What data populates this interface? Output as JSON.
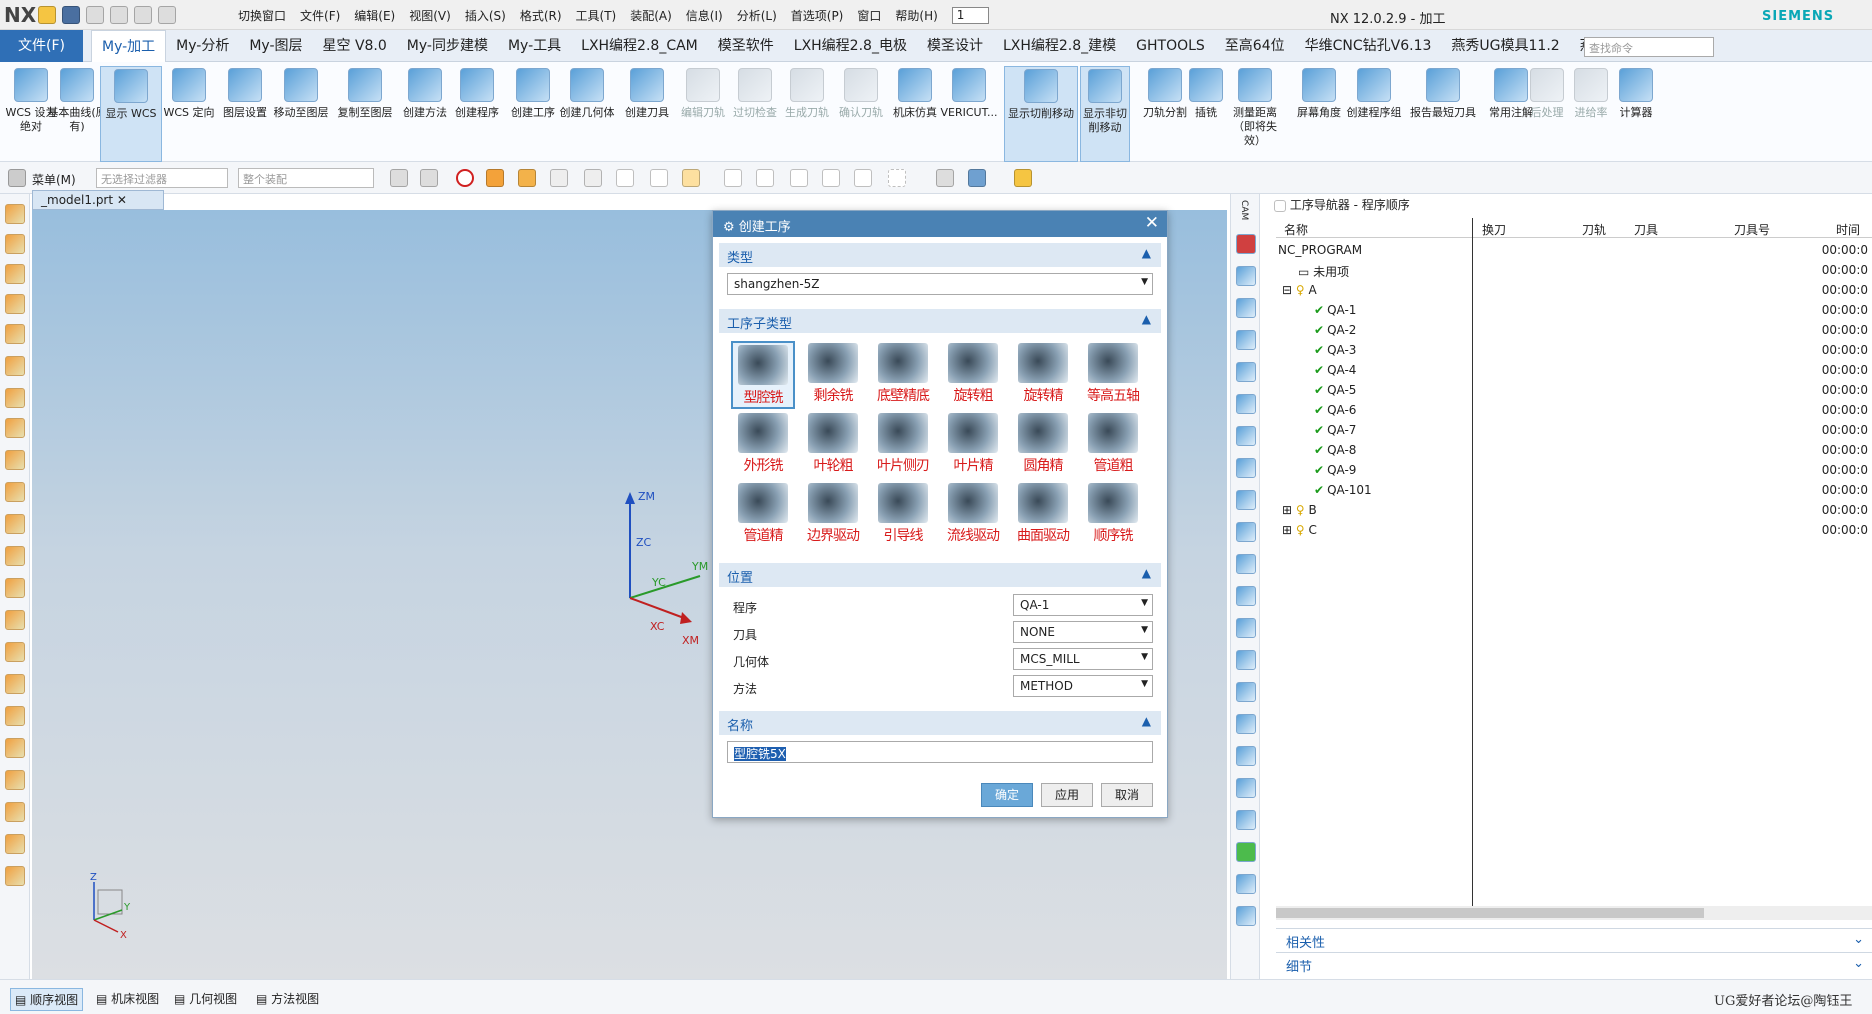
{
  "titlebar": {
    "logo": "NX",
    "window_title": "NX 12.0.2.9 - 加工",
    "brand": "SIEMENS",
    "menus": [
      "切换窗口",
      "文件(F)",
      "编辑(E)",
      "视图(V)",
      "插入(S)",
      "格式(R)",
      "工具(T)",
      "装配(A)",
      "信息(I)",
      "分析(L)",
      "首选项(P)",
      "窗口",
      "帮助(H)"
    ],
    "field_value": "1"
  },
  "ribbon_tabs": [
    "文件(F)",
    "My-加工",
    "My-分析",
    "My-图层",
    "星空 V8.0",
    "My-同步建模",
    "My-工具",
    "LXH编程2.8_CAM",
    "模圣软件",
    "LXH编程2.8_电极",
    "模圣设计",
    "LXH编程2.8_建模",
    "GHTOOLS",
    "至高64位",
    "华维CNC钻孔V6.13",
    "燕秀UG模具11.2",
    "燕秀UG工具"
  ],
  "active_tab": "My-加工",
  "search_placeholder": "查找命令",
  "ribbon_buttons": [
    {
      "label": "WCS 设为绝对",
      "state": "normal"
    },
    {
      "label": "基本曲线(原有)",
      "state": "normal"
    },
    {
      "label": "显示 WCS",
      "state": "selected"
    },
    {
      "label": "WCS 定向",
      "state": "normal"
    },
    {
      "label": "图层设置",
      "state": "normal"
    },
    {
      "label": "移动至图层",
      "state": "normal"
    },
    {
      "label": "复制至图层",
      "state": "normal"
    },
    {
      "label": "创建方法",
      "state": "normal"
    },
    {
      "label": "创建程序",
      "state": "normal"
    },
    {
      "label": "创建工序",
      "state": "normal"
    },
    {
      "label": "创建几何体",
      "state": "normal"
    },
    {
      "label": "创建刀具",
      "state": "normal"
    },
    {
      "label": "编辑刀轨",
      "state": "disabled"
    },
    {
      "label": "过切检查",
      "state": "disabled"
    },
    {
      "label": "生成刀轨",
      "state": "disabled"
    },
    {
      "label": "确认刀轨",
      "state": "disabled"
    },
    {
      "label": "机床仿真",
      "state": "normal"
    },
    {
      "label": "VERICUT...",
      "state": "normal"
    },
    {
      "label": "显示切削移动",
      "state": "selected"
    },
    {
      "label": "显示非切削移动",
      "state": "selected"
    },
    {
      "label": "刀轨分割",
      "state": "normal"
    },
    {
      "label": "插铣",
      "state": "normal"
    },
    {
      "label": "测量距离（即将失效）",
      "state": "normal"
    },
    {
      "label": "屏幕角度",
      "state": "normal"
    },
    {
      "label": "创建程序组",
      "state": "normal"
    },
    {
      "label": "报告最短刀具",
      "state": "normal"
    },
    {
      "label": "常用注解",
      "state": "normal"
    },
    {
      "label": "后处理",
      "state": "disabled"
    },
    {
      "label": "进给率",
      "state": "disabled"
    },
    {
      "label": "计算器",
      "state": "normal"
    }
  ],
  "toolbar2": {
    "menu_label": "菜单(M)",
    "filter": "无选择过滤器",
    "assembly": "整个装配"
  },
  "doc_tab": "_model1.prt",
  "axes": {
    "zm": "ZM",
    "zc": "ZC",
    "yc": "YC",
    "ym": "YM",
    "xc": "XC",
    "xm": "XM",
    "z": "Z",
    "y": "Y",
    "x": "X"
  },
  "dialog": {
    "title": "创建工序",
    "type_section": "类型",
    "type_value": "shangzhen-5Z",
    "subtype_section": "工序子类型",
    "subtypes": [
      [
        "型腔铣",
        "剩余铣",
        "底壁精底",
        "旋转粗",
        "旋转精",
        "等高五轴"
      ],
      [
        "外形铣",
        "叶轮粗",
        "叶片侧刃",
        "叶片精",
        "圆角精",
        "管道粗"
      ],
      [
        "管道精",
        "边界驱动",
        "引导线",
        "流线驱动",
        "曲面驱动",
        "顺序铣"
      ]
    ],
    "location_section": "位置",
    "fields": [
      {
        "label": "程序",
        "value": "QA-1"
      },
      {
        "label": "刀具",
        "value": "NONE"
      },
      {
        "label": "几何体",
        "value": "MCS_MILL"
      },
      {
        "label": "方法",
        "value": "METHOD"
      }
    ],
    "name_section": "名称",
    "name_value": "型腔铣5X",
    "ok": "确定",
    "apply": "应用",
    "cancel": "取消"
  },
  "navigator": {
    "title": "工序导航器 - 程序顺序",
    "columns": [
      "名称",
      "换刀",
      "刀轨",
      "刀具",
      "刀具号",
      "时间"
    ],
    "rows": [
      {
        "name": "NC_PROGRAM",
        "time": "00:00:0"
      },
      {
        "name": "未用项",
        "time": "00:00:0"
      },
      {
        "name": "A",
        "time": "00:00:0"
      },
      {
        "name": "QA-1",
        "time": "00:00:0"
      },
      {
        "name": "QA-2",
        "time": "00:00:0"
      },
      {
        "name": "QA-3",
        "time": "00:00:0"
      },
      {
        "name": "QA-4",
        "time": "00:00:0"
      },
      {
        "name": "QA-5",
        "time": "00:00:0"
      },
      {
        "name": "QA-6",
        "time": "00:00:0"
      },
      {
        "name": "QA-7",
        "time": "00:00:0"
      },
      {
        "name": "QA-8",
        "time": "00:00:0"
      },
      {
        "name": "QA-9",
        "time": "00:00:0"
      },
      {
        "name": "QA-101",
        "time": "00:00:0"
      },
      {
        "name": "B",
        "time": "00:00:0"
      },
      {
        "name": "C",
        "time": "00:00:0"
      }
    ],
    "sections": [
      "相关性",
      "细节"
    ]
  },
  "bottom_tabs": [
    "顺序视图",
    "机床视图",
    "几何视图",
    "方法视图"
  ],
  "watermark": "UG爱好者论坛@陶钰王"
}
